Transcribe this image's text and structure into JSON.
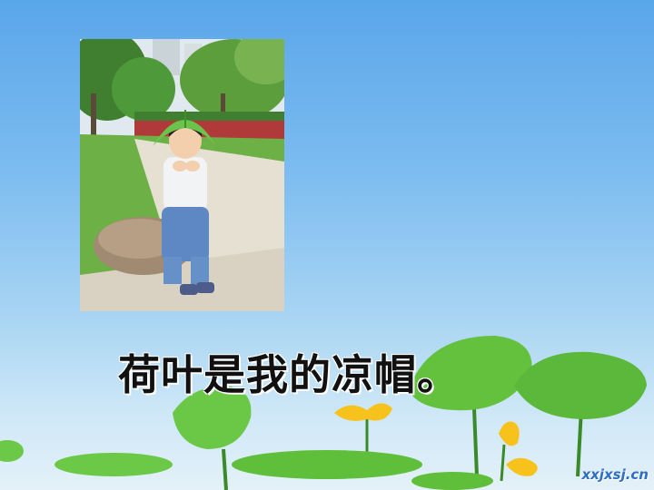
{
  "caption": {
    "text": "荷叶是我的凉帽。"
  },
  "watermark": {
    "text": "xxjxsj.cn"
  },
  "photo": {
    "icon": "girl-with-lotus-leaf-hat-photo"
  },
  "colors": {
    "sky_top": "#5aa6ea",
    "sky_bottom": "#e4f1f8",
    "leaf": "#5fbf3a",
    "flower": "#f7c21c"
  }
}
